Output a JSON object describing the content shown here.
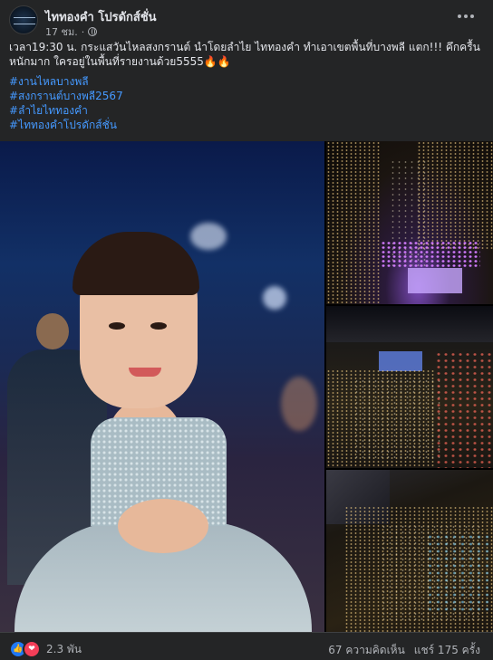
{
  "post": {
    "page_name": "ไททองคำ โปรดักส์ชั่น",
    "time": "17 ชม.",
    "separator": "·",
    "privacy_icon": "globe-icon",
    "message": "เวลา19:30 น. กระแสวันไหลสงกรานต์ นำโดยลำไย ไททองคำ ทำเอาเขตพื้นที่บางพลี แตก!!! คึกครื้นหนักมาก ใครอยู่ในพื้นที่รายงานด้วย5555🔥🔥",
    "hashtags": [
      "#งานไหลบางพลี",
      "#สงกรานต์บางพลี2567",
      "#ลำไยไททองคำ",
      "#ไททองคำโปรดักส์ชั่น"
    ]
  },
  "footer": {
    "reaction_icons": [
      "like-icon",
      "love-icon"
    ],
    "reaction_count": "2.3 พัน",
    "comments": "67 ความคิดเห็น",
    "shares": "แชร์ 175 ครั้ง"
  },
  "colors": {
    "background": "#242526",
    "text": "#e4e6eb",
    "secondary_text": "#b0b3b8",
    "hashtag": "#4599ff",
    "like": "#2078f4",
    "love": "#f33e58"
  }
}
